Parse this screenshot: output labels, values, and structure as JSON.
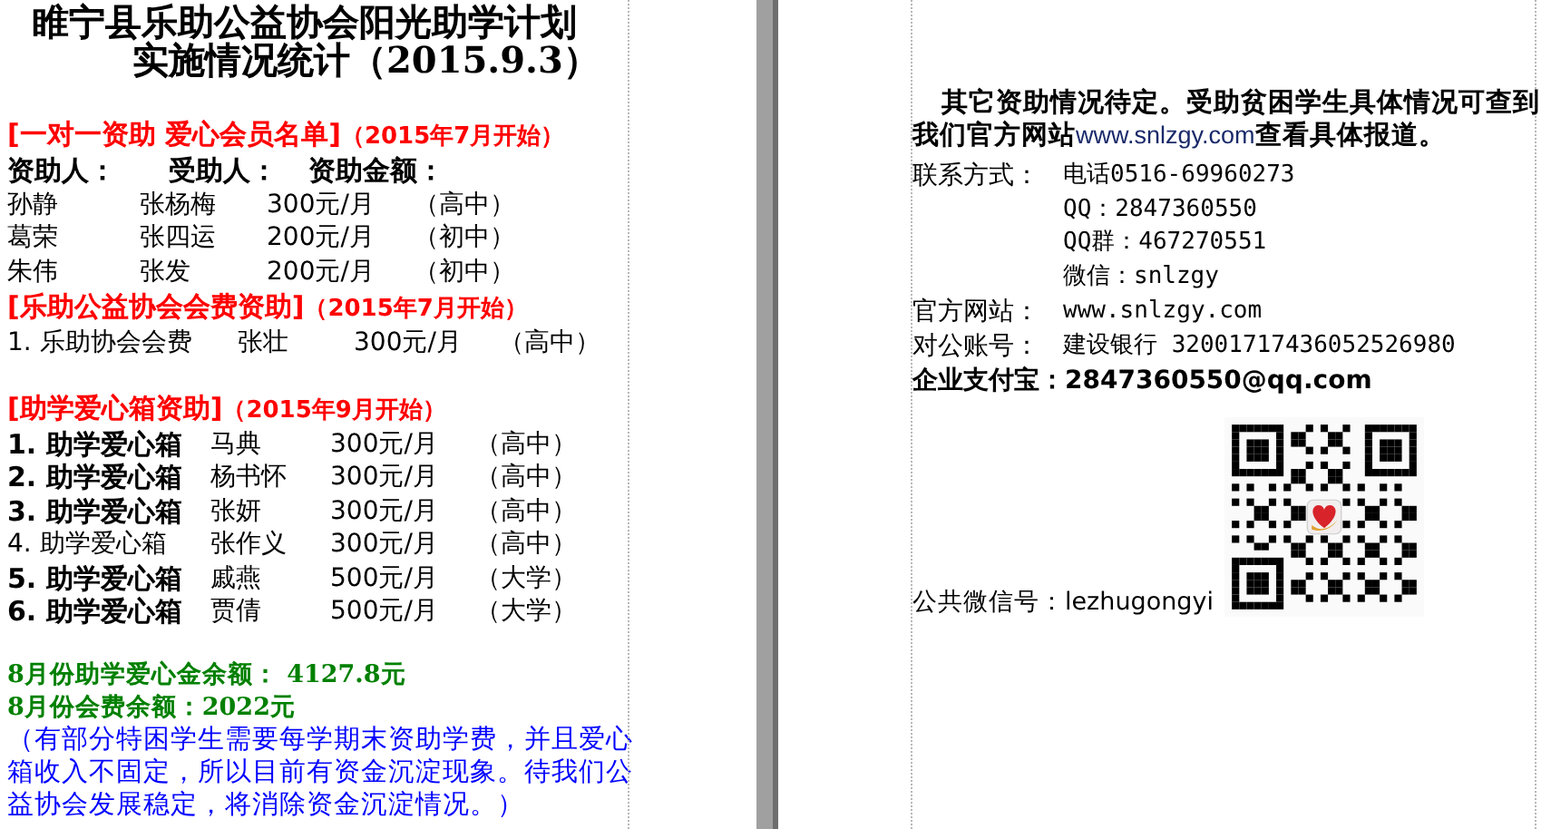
{
  "left_page": {
    "title_lines": [
      "睢宁县乐助公益协会阳光助学计划",
      "实施情况统计（2015.9.3）"
    ],
    "sections": [
      {
        "heading": "[一对一资助 爱心会员名单]",
        "period": "（2015年7月开始）",
        "columns": [
          "资助人：",
          "受助人：",
          "资助金额："
        ],
        "rows": [
          {
            "bold": false,
            "cells": [
              "孙静",
              "张杨梅",
              "300元/月",
              "（高中）"
            ]
          },
          {
            "bold": false,
            "cells": [
              "葛荣",
              "张四运",
              "200元/月",
              "（初中）"
            ]
          },
          {
            "bold": false,
            "cells": [
              "朱伟",
              "张发",
              "200元/月",
              "（初中）"
            ]
          }
        ]
      },
      {
        "heading": "[乐助公益协会会费资助]",
        "period": "（2015年7月开始）",
        "rows": [
          {
            "bold": false,
            "cells": [
              "1.  乐助协会会费",
              "张壮",
              "300元/月",
              "（高中）"
            ]
          }
        ]
      },
      {
        "heading": "[助学爱心箱资助]",
        "period": "（2015年9月开始）",
        "rows": [
          {
            "bold": true,
            "cells": [
              "1. 助学爱心箱",
              "马典",
              "300元/月",
              "（高中）"
            ]
          },
          {
            "bold": true,
            "cells": [
              "2. 助学爱心箱",
              "杨书怀",
              "300元/月",
              "（高中）"
            ]
          },
          {
            "bold": true,
            "cells": [
              "3. 助学爱心箱",
              "张妍",
              "300元/月",
              "（高中）"
            ]
          },
          {
            "bold": false,
            "cells": [
              "4. 助学爱心箱",
              "张作义",
              "300元/月",
              "（高中）"
            ]
          },
          {
            "bold": true,
            "cells": [
              "5. 助学爱心箱",
              "戚燕",
              "500元/月",
              "（大学）"
            ]
          },
          {
            "bold": true,
            "cells": [
              "6. 助学爱心箱",
              "贾倩",
              "500元/月",
              "（大学）"
            ]
          }
        ]
      }
    ],
    "balances": [
      "8月份助学爱心金余额：  4127.8元",
      "8月份会费余额：2022元"
    ],
    "note": "（有部分特困学生需要每学期末资助学费，并且爱心箱收入不固定，所以目前有资金沉淀现象。待我们公益协会发展稳定，将消除资金沉淀情况。）"
  },
  "right_page": {
    "intro_before": "其它资助情况待定。受助贫困学生具体情况可查到我们官方网站",
    "intro_link": "www.snlzgy.com",
    "intro_after": "查看具体报道。",
    "contacts": [
      {
        "label": "联系方式：",
        "value": "电话0516-69960273"
      },
      {
        "value": "QQ：2847360550"
      },
      {
        "value": "QQ群：467270551"
      },
      {
        "value": "微信：snlzgy"
      },
      {
        "label": "官方网站：",
        "value": "www.snlzgy.com"
      },
      {
        "label": "对公账号：",
        "value": "建设银行 32001717436052526980"
      }
    ],
    "alipay": "企业支付宝：2847360550@qq.com",
    "wechat": "公共微信号：lezhugongyi"
  }
}
